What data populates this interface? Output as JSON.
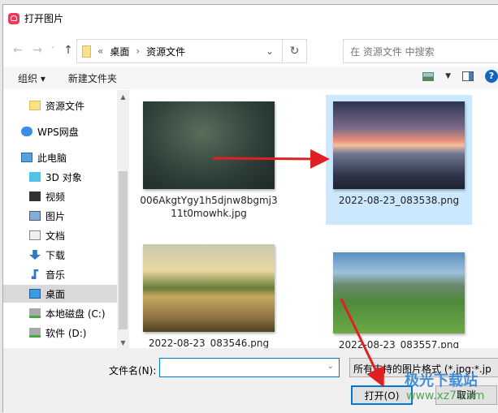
{
  "window": {
    "title": "打开图片"
  },
  "nav": {
    "back": "←",
    "forward": "→",
    "recent": "˅",
    "up": "↑",
    "breadcrumb_prefix": "«",
    "breadcrumb": [
      "桌面",
      "资源文件"
    ],
    "refresh": "↻",
    "search_placeholder": "在 资源文件 中搜索",
    "dropdown": "⌄"
  },
  "toolbar": {
    "organize": "组织 ▾",
    "new_folder": "新建文件夹",
    "help": "?"
  },
  "sidebar": {
    "items": [
      {
        "label": "资源文件",
        "icon": "folder-icon"
      },
      {
        "label": "WPS网盘",
        "icon": "cloud-icon"
      },
      {
        "label": "此电脑",
        "icon": "computer-icon"
      },
      {
        "label": "3D 对象",
        "icon": "cube-icon"
      },
      {
        "label": "视频",
        "icon": "video-icon"
      },
      {
        "label": "图片",
        "icon": "picture-icon"
      },
      {
        "label": "文档",
        "icon": "document-icon"
      },
      {
        "label": "下载",
        "icon": "download-icon"
      },
      {
        "label": "音乐",
        "icon": "music-icon"
      },
      {
        "label": "桌面",
        "icon": "desktop-icon",
        "selected": true
      },
      {
        "label": "本地磁盘 (C:)",
        "icon": "drive-icon"
      },
      {
        "label": "软件 (D:)",
        "icon": "drive-icon"
      }
    ]
  },
  "files": [
    {
      "name": "006AkgtYgy1h5djnw8bgmj311t0mowhk.jpg"
    },
    {
      "name": "2022-08-23_083538.png",
      "selected": true
    },
    {
      "name": "2022-08-23_083546.png"
    },
    {
      "name": "2022-08-23_083557.png"
    }
  ],
  "bottom": {
    "filename_label": "文件名(N):",
    "filename_value": "",
    "filter": "所有支持的图片格式 (*.jpg;*.jp",
    "open": "打开(O)",
    "cancel": "取消"
  },
  "watermark": {
    "text": "极光下载站",
    "url": "www.xz7.com"
  },
  "colors": {
    "accent": "#0078d7",
    "selection": "#cce8ff",
    "arrow": "#e02020"
  }
}
